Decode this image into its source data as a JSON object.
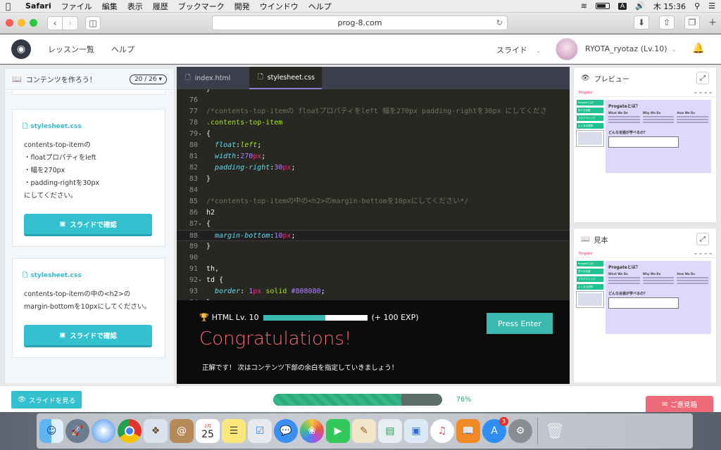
{
  "menubar": {
    "app": "Safari",
    "items": [
      "ファイル",
      "編集",
      "表示",
      "履歴",
      "ブックマーク",
      "開発",
      "ウインドウ",
      "ヘルプ"
    ],
    "input_badge": "A",
    "clock": "木 15:36"
  },
  "browser": {
    "url": "prog-8.com"
  },
  "header": {
    "nav": [
      "レッスン一覧",
      "ヘルプ"
    ],
    "slide_label": "スライド",
    "username": "RYOTA_ryotaz (Lv.10)"
  },
  "left_panel": {
    "title": "コンテンツを作ろう！",
    "progress": "20 / 26",
    "cards": [
      {
        "file": "stylesheet.css",
        "lines": [
          "contents-top-itemの",
          "・floatプロパティをleft",
          "・幅を270px",
          "・padding-rightを30px",
          "にしてください。"
        ],
        "button": "スライドで確認"
      },
      {
        "file": "stylesheet.css",
        "lines": [
          "contents-top-itemの中の<h2>の",
          "margin-bottomを10pxにしてください。"
        ],
        "button": "スライドで確認"
      }
    ]
  },
  "editor": {
    "tabs": [
      "index.html",
      "stylesheet.css"
    ],
    "active_tab": 1,
    "lines": [
      {
        "n": "",
        "segs": [
          [
            "w",
            "}"
          ]
        ]
      },
      {
        "n": "76",
        "segs": []
      },
      {
        "n": "77",
        "segs": [
          [
            "cm",
            "/*contents-top-itemの floatプロパティをleft 幅を270px padding-rightを30px にしてくださ"
          ]
        ]
      },
      {
        "n": "78",
        "segs": [
          [
            "sel",
            ".contents-top-item"
          ]
        ]
      },
      {
        "n": "79",
        "fold": true,
        "segs": [
          [
            "w",
            "{"
          ]
        ]
      },
      {
        "n": "80",
        "segs": [
          [
            "w",
            "  "
          ],
          [
            "prop",
            "float"
          ],
          [
            "w",
            ":"
          ],
          [
            "val",
            "left"
          ],
          [
            "w",
            ";"
          ]
        ]
      },
      {
        "n": "81",
        "segs": [
          [
            "w",
            "  "
          ],
          [
            "prop",
            "width"
          ],
          [
            "w",
            ":"
          ],
          [
            "num",
            "270"
          ],
          [
            "unit",
            "px"
          ],
          [
            "w",
            ";"
          ]
        ]
      },
      {
        "n": "82",
        "segs": [
          [
            "w",
            "  "
          ],
          [
            "prop",
            "padding-right"
          ],
          [
            "w",
            ":"
          ],
          [
            "num",
            "30"
          ],
          [
            "unit",
            "px"
          ],
          [
            "w",
            ";"
          ]
        ]
      },
      {
        "n": "83",
        "segs": [
          [
            "w",
            "}"
          ]
        ]
      },
      {
        "n": "84",
        "segs": []
      },
      {
        "n": "85",
        "segs": [
          [
            "cm",
            "/*contents-top-itemの中の<h2>のmargin-bottomを10pxにしてください*/"
          ]
        ]
      },
      {
        "n": "86",
        "segs": [
          [
            "w",
            "h2"
          ]
        ]
      },
      {
        "n": "87",
        "fold": true,
        "segs": [
          [
            "w",
            "{"
          ]
        ]
      },
      {
        "n": "88",
        "hl": true,
        "segs": [
          [
            "w",
            "  "
          ],
          [
            "prop",
            "margin-bottom"
          ],
          [
            "w",
            ":"
          ],
          [
            "num",
            "10"
          ],
          [
            "unit",
            "px"
          ],
          [
            "w",
            ";"
          ]
        ]
      },
      {
        "n": "89",
        "segs": [
          [
            "w",
            "}"
          ]
        ]
      },
      {
        "n": "90",
        "segs": []
      },
      {
        "n": "91",
        "segs": [
          [
            "w",
            "th,"
          ]
        ]
      },
      {
        "n": "92",
        "fold": true,
        "segs": [
          [
            "w",
            "td {"
          ]
        ]
      },
      {
        "n": "93",
        "segs": [
          [
            "w",
            "  "
          ],
          [
            "prop",
            "border"
          ],
          [
            "w",
            ": "
          ],
          [
            "num",
            "1"
          ],
          [
            "unit",
            "px"
          ],
          [
            "w",
            " "
          ],
          [
            "sel",
            "solid"
          ],
          [
            "w",
            " "
          ],
          [
            "num",
            "#808080"
          ],
          [
            "w",
            ";"
          ]
        ]
      },
      {
        "n": "94",
        "segs": [
          [
            "w",
            "}"
          ]
        ]
      }
    ]
  },
  "congrats": {
    "level": "HTML Lv. 10",
    "exp_progress": 0.6,
    "exp_gain": "(+ 100 EXP)",
    "title": "Congratulations!",
    "message": "正解です！ 次はコンテンツ下部の余白を指定していきましょう！",
    "button": "Press Enter"
  },
  "preview": {
    "title": "プレビュー",
    "example_title": "見本",
    "brand": "Progate",
    "heading": "Progateとは？",
    "col_titles": [
      "What We Do",
      "Why We Do",
      "How We Do"
    ],
    "sub_heading": "どんな言語が学べるの？",
    "side_items": [
      "Progateとは？",
      "学べる言語",
      "プログラミング",
      "よくある質問"
    ]
  },
  "bottom": {
    "slide_button": "スライドを見る",
    "progress": 0.76,
    "progress_label": "76%",
    "opinion_button": "ご意見箱"
  },
  "colors": {
    "accent": "#33c1cf",
    "exp": "#3bb9b0",
    "congrats": "#ef6a78"
  },
  "dock": {
    "calendar_month": "2月",
    "calendar_day": "25",
    "appstore_badge": "3"
  }
}
